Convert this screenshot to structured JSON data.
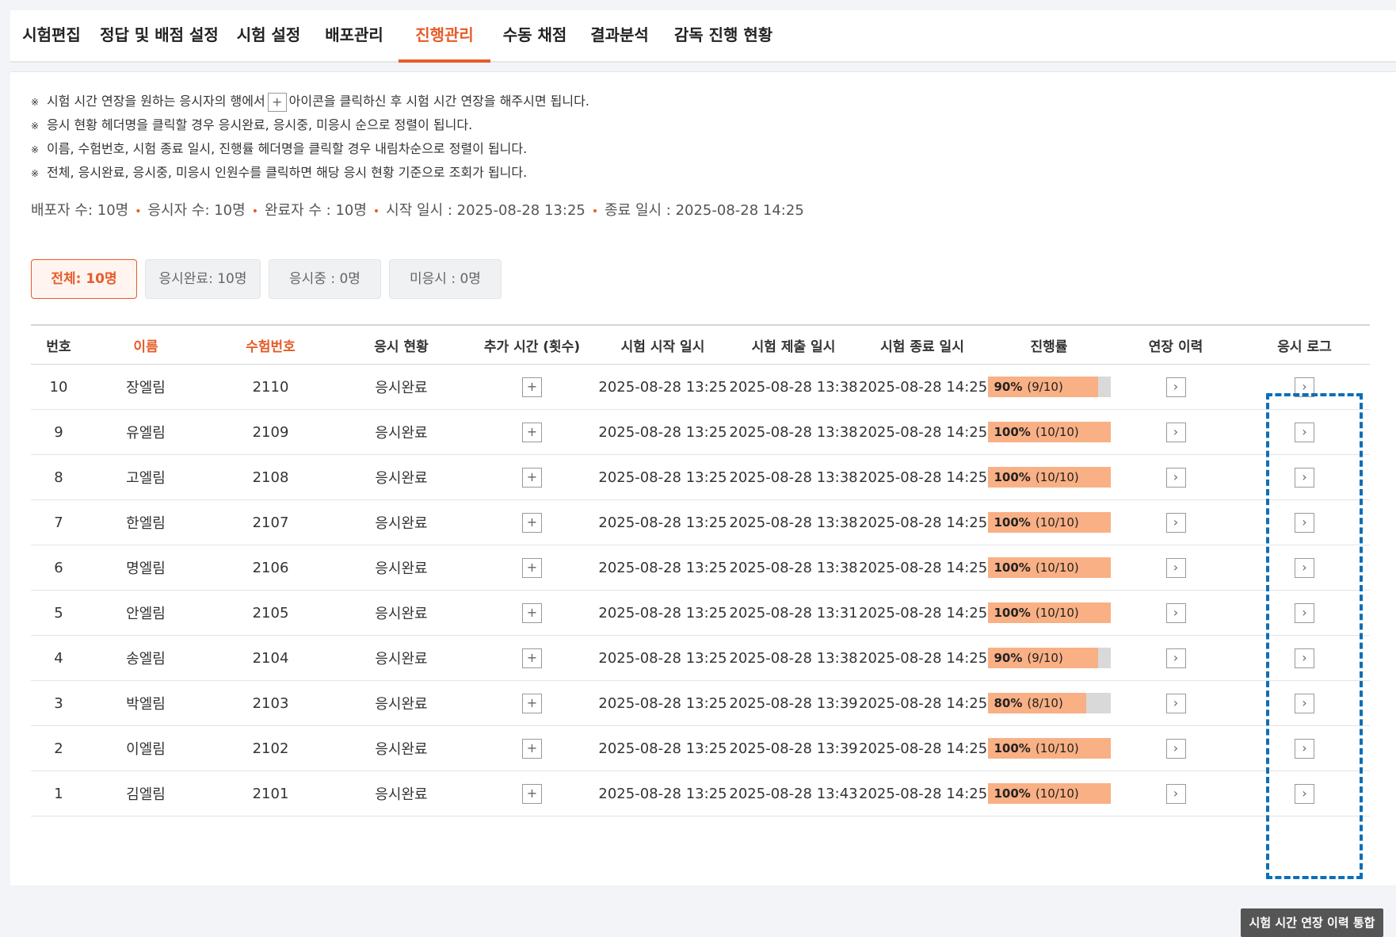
{
  "tabs": [
    {
      "label": "시험편집"
    },
    {
      "label": "정답 및 배점 설정"
    },
    {
      "label": "시험 설정"
    },
    {
      "label": "배포관리"
    },
    {
      "label": "진행관리"
    },
    {
      "label": "수동 채점"
    },
    {
      "label": "결과분석"
    },
    {
      "label": "감독 진행 현황"
    }
  ],
  "notes": {
    "bullet": "※",
    "n1_pre": "시험 시간 연장을 원하는 응시자의 행에서",
    "n1_icon": "+",
    "n1_post": "아이콘을 클릭하신 후 시험 시간 연장을 해주시면 됩니다.",
    "n2": "응시 현황 헤더명을 클릭할 경우 응시완료, 응시중, 미응시 순으로 정렬이 됩니다.",
    "n3": "이름, 수험번호, 시험 종료 일시, 진행률 헤더명을 클릭할 경우 내림차순으로 정렬이 됩니다.",
    "n4": "전체, 응시완료, 응시중, 미응시 인원수를 클릭하면 해당 응시 현황 기준으로 조회가 됩니다."
  },
  "summary": {
    "distributed": "배포자 수: 10명",
    "examinees": "응시자 수: 10명",
    "completed": "완료자 수 : 10명",
    "start": "시작 일시 : 2025-08-28 13:25",
    "end": "종료 일시 : 2025-08-28 14:25",
    "dot": "•"
  },
  "filters": {
    "all": "전체: 10명",
    "done": "응시완료: 10명",
    "ongoing": "응시중 : 0명",
    "none": "미응시 : 0명"
  },
  "table": {
    "headers": {
      "no": "번호",
      "name": "이름",
      "examno": "수험번호",
      "status": "응시 현황",
      "extra": "추가 시간 (횟수)",
      "start": "시험 시작 일시",
      "submit": "시험 제출 일시",
      "end": "시험 종료 일시",
      "progress": "진행률",
      "extlog": "연장 이력",
      "examlog": "응시 로그"
    },
    "rows": [
      {
        "no": "10",
        "name": "장엘림",
        "examno": "2110",
        "status": "응시완료",
        "start": "2025-08-28 13:25",
        "submit": "2025-08-28 13:38",
        "end": "2025-08-28 14:25",
        "pct": "90%",
        "frac": "(9/10)",
        "progress": 0.9
      },
      {
        "no": "9",
        "name": "유엘림",
        "examno": "2109",
        "status": "응시완료",
        "start": "2025-08-28 13:25",
        "submit": "2025-08-28 13:38",
        "end": "2025-08-28 14:25",
        "pct": "100%",
        "frac": "(10/10)",
        "progress": 1.0
      },
      {
        "no": "8",
        "name": "고엘림",
        "examno": "2108",
        "status": "응시완료",
        "start": "2025-08-28 13:25",
        "submit": "2025-08-28 13:38",
        "end": "2025-08-28 14:25",
        "pct": "100%",
        "frac": "(10/10)",
        "progress": 1.0
      },
      {
        "no": "7",
        "name": "한엘림",
        "examno": "2107",
        "status": "응시완료",
        "start": "2025-08-28 13:25",
        "submit": "2025-08-28 13:38",
        "end": "2025-08-28 14:25",
        "pct": "100%",
        "frac": "(10/10)",
        "progress": 1.0
      },
      {
        "no": "6",
        "name": "명엘림",
        "examno": "2106",
        "status": "응시완료",
        "start": "2025-08-28 13:25",
        "submit": "2025-08-28 13:38",
        "end": "2025-08-28 14:25",
        "pct": "100%",
        "frac": "(10/10)",
        "progress": 1.0
      },
      {
        "no": "5",
        "name": "안엘림",
        "examno": "2105",
        "status": "응시완료",
        "start": "2025-08-28 13:25",
        "submit": "2025-08-28 13:31",
        "end": "2025-08-28 14:25",
        "pct": "100%",
        "frac": "(10/10)",
        "progress": 1.0
      },
      {
        "no": "4",
        "name": "송엘림",
        "examno": "2104",
        "status": "응시완료",
        "start": "2025-08-28 13:25",
        "submit": "2025-08-28 13:38",
        "end": "2025-08-28 14:25",
        "pct": "90%",
        "frac": "(9/10)",
        "progress": 0.9
      },
      {
        "no": "3",
        "name": "박엘림",
        "examno": "2103",
        "status": "응시완료",
        "start": "2025-08-28 13:25",
        "submit": "2025-08-28 13:39",
        "end": "2025-08-28 14:25",
        "pct": "80%",
        "frac": "(8/10)",
        "progress": 0.8
      },
      {
        "no": "2",
        "name": "이엘림",
        "examno": "2102",
        "status": "응시완료",
        "start": "2025-08-28 13:25",
        "submit": "2025-08-28 13:39",
        "end": "2025-08-28 14:25",
        "pct": "100%",
        "frac": "(10/10)",
        "progress": 1.0
      },
      {
        "no": "1",
        "name": "김엘림",
        "examno": "2101",
        "status": "응시완료",
        "start": "2025-08-28 13:25",
        "submit": "2025-08-28 13:43",
        "end": "2025-08-28 14:25",
        "pct": "100%",
        "frac": "(10/10)",
        "progress": 1.0
      }
    ]
  },
  "icons": {
    "plus": "+",
    "arrow": "›"
  },
  "merge_button": "시험 시간 연장 이력 통합",
  "colors": {
    "accent": "#e65c2a",
    "progress_fill": "#f9b085",
    "progress_track": "#d9d9d9",
    "highlight": "#0b6fb8"
  }
}
